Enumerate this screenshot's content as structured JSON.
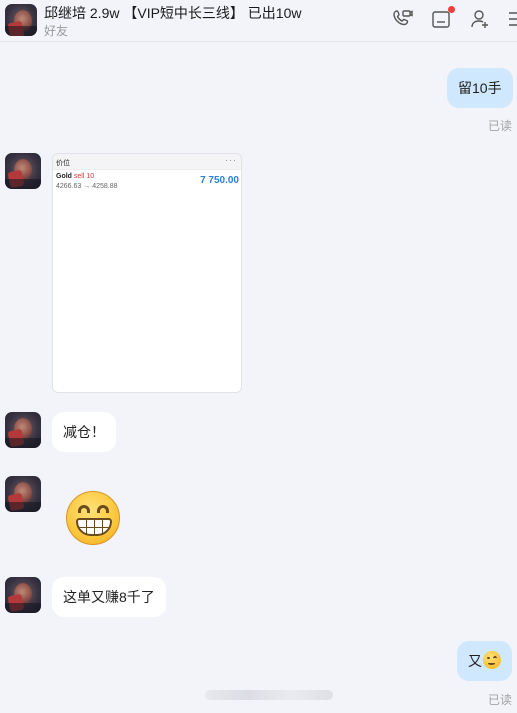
{
  "header": {
    "title": "邱继培 2.9w 【VIP短中长三线】 已出10w",
    "subtitle": "好友",
    "icons": [
      "phone-video-icon",
      "inbox-icon",
      "add-friend-icon",
      "more-icon"
    ],
    "notification_dot_color": "#f23d3d"
  },
  "messages": [
    {
      "sender": "self",
      "type": "text",
      "text": "留10手",
      "read": "已读"
    },
    {
      "sender": "other",
      "type": "trade-card",
      "card": {
        "header": "价位",
        "menu": "···",
        "symbol": "Gold",
        "action": "sell 10",
        "prices": "4266.63 → 4258.88",
        "amount": "7 750.00"
      }
    },
    {
      "sender": "other",
      "type": "text",
      "text": "减仓！"
    },
    {
      "sender": "other",
      "type": "emoji",
      "emoji": "grinning-face"
    },
    {
      "sender": "other",
      "type": "text",
      "text": "这单又赚8千了"
    },
    {
      "sender": "self",
      "type": "text",
      "text": "又",
      "trailing_emoji": "smirk-emoji",
      "read": "已读"
    }
  ],
  "colors": {
    "self_bubble": "#cfe8fd",
    "other_bubble": "#ffffff",
    "background": "#f3f4f9",
    "amount_blue": "#2c7fd6",
    "sell_red": "#d2373a"
  }
}
